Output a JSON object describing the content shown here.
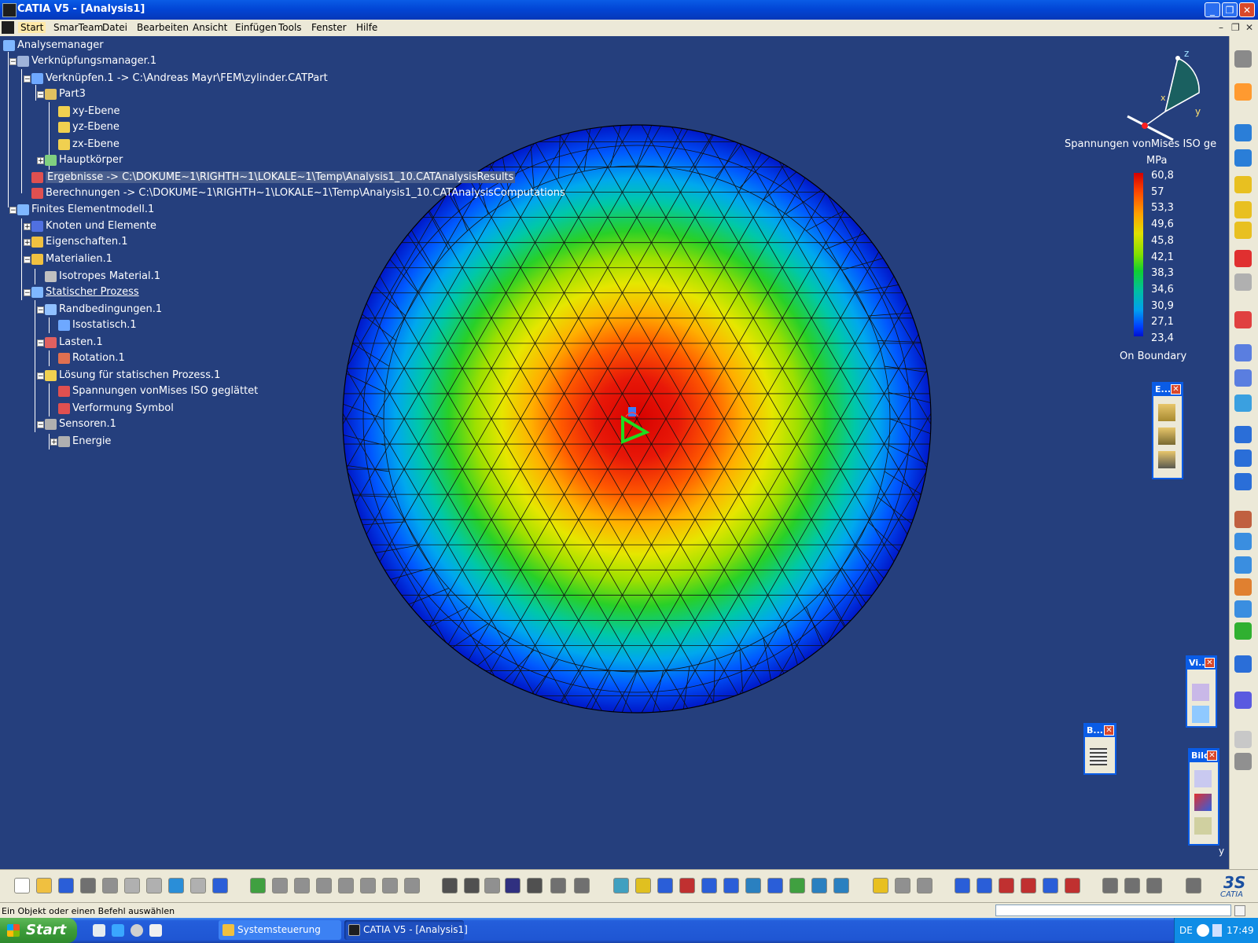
{
  "window": {
    "title": "CATIA V5 - [Analysis1]",
    "minimize": "_",
    "maximize": "❐",
    "close": "✕"
  },
  "menu": {
    "items": [
      "Start",
      "SmarTeam",
      "Datei",
      "Bearbeiten",
      "Ansicht",
      "Einfügen",
      "Tools",
      "Fenster",
      "Hilfe"
    ],
    "doc_controls": [
      "–",
      "❐",
      "✕"
    ]
  },
  "tree": {
    "nodes": [
      {
        "label": "Analysemanager",
        "icon": "analysis-manager-icon",
        "color": "#7fb7ff"
      },
      {
        "label": "Verknüpfungsmanager.1",
        "icon": "link-manager-icon",
        "color": "#9fb3d9"
      },
      {
        "label": "Verknüpfen.1 -> C:\\Andreas Mayr\\FEM\\zylinder.CATPart",
        "icon": "link-icon",
        "color": "#6ea8ff"
      },
      {
        "label": "Part3",
        "icon": "part-gear-icon",
        "color": "#e0c060"
      },
      {
        "label": "xy-Ebene",
        "icon": "plane-icon",
        "color": "#f0d050"
      },
      {
        "label": "yz-Ebene",
        "icon": "plane-icon",
        "color": "#f0d050"
      },
      {
        "label": "zx-Ebene",
        "icon": "plane-icon",
        "color": "#f0d050"
      },
      {
        "label": "Hauptkörper",
        "icon": "body-gear-icon",
        "color": "#80d080"
      },
      {
        "label": "Ergebnisse -> C:\\DOKUME~1\\RIGHTH~1\\LOKALE~1\\Temp\\Analysis1_10.CATAnalysisResults",
        "icon": "results-icon",
        "color": "#e05050"
      },
      {
        "label": "Berechnungen -> C:\\DOKUME~1\\RIGHTH~1\\LOKALE~1\\Temp\\Analysis1_10.CATAnalysisComputations",
        "icon": "computations-icon",
        "color": "#e05050"
      },
      {
        "label": "Finites Elementmodell.1",
        "icon": "fem-model-icon",
        "color": "#7fb7ff"
      },
      {
        "label": "Knoten und Elemente",
        "icon": "nodes-elements-icon",
        "color": "#5070e0"
      },
      {
        "label": "Eigenschaften.1",
        "icon": "folder-icon",
        "color": "#f0c040"
      },
      {
        "label": "Materialien.1",
        "icon": "folder-icon",
        "color": "#f0c040"
      },
      {
        "label": "Isotropes Material.1",
        "icon": "material-icon",
        "color": "#c0c0c0"
      },
      {
        "label": "Statischer Prozess",
        "icon": "static-case-icon",
        "color": "#7fb7ff"
      },
      {
        "label": "Randbedingungen.1",
        "icon": "restraints-icon",
        "color": "#90c0ff"
      },
      {
        "label": "Isostatisch.1",
        "icon": "isostatic-icon",
        "color": "#6ea8ff"
      },
      {
        "label": "Lasten.1",
        "icon": "loads-icon",
        "color": "#e06060"
      },
      {
        "label": "Rotation.1",
        "icon": "rotation-icon",
        "color": "#e07050"
      },
      {
        "label": "Lösung für statischen Prozess.1",
        "icon": "solution-icon",
        "color": "#f0d050"
      },
      {
        "label": "Spannungen vonMises ISO geglättet",
        "icon": "von-mises-image-icon",
        "color": "#e05050"
      },
      {
        "label": "Verformung Symbol",
        "icon": "deformation-image-icon",
        "color": "#e05050"
      },
      {
        "label": "Sensoren.1",
        "icon": "sensors-icon",
        "color": "#b0b0b0"
      },
      {
        "label": "Energie",
        "icon": "energy-sensor-icon",
        "color": "#b0b0b0"
      }
    ]
  },
  "compass": {
    "x": "x",
    "y": "y",
    "z": "z"
  },
  "legend": {
    "title": "Spannungen vonMises ISO ge",
    "unit": "MPa",
    "values": [
      "60,8",
      "57",
      "53,3",
      "49,6",
      "45,8",
      "42,1",
      "38,3",
      "34,6",
      "30,9",
      "27,1",
      "23,4"
    ],
    "footer": "On Boundary"
  },
  "floating_toolbars": {
    "e": {
      "title": "E..."
    },
    "vi": {
      "title": "Vi..."
    },
    "b": {
      "title": "B..."
    },
    "bild": {
      "title": "Bild"
    }
  },
  "axis_corner": "y",
  "status": {
    "text": "Ein Objekt oder einen Befehl auswählen"
  },
  "taskbar": {
    "start": "Start",
    "tasks": [
      {
        "label": "Systemsteuerung"
      },
      {
        "label": "CATIA V5 - [Analysis1]"
      }
    ],
    "tray": {
      "lang": "DE",
      "time": "17:49"
    }
  },
  "catia_logo": "CATIA",
  "colors": {
    "viewport": "#253f7d",
    "accent": "#0a5ce6"
  }
}
